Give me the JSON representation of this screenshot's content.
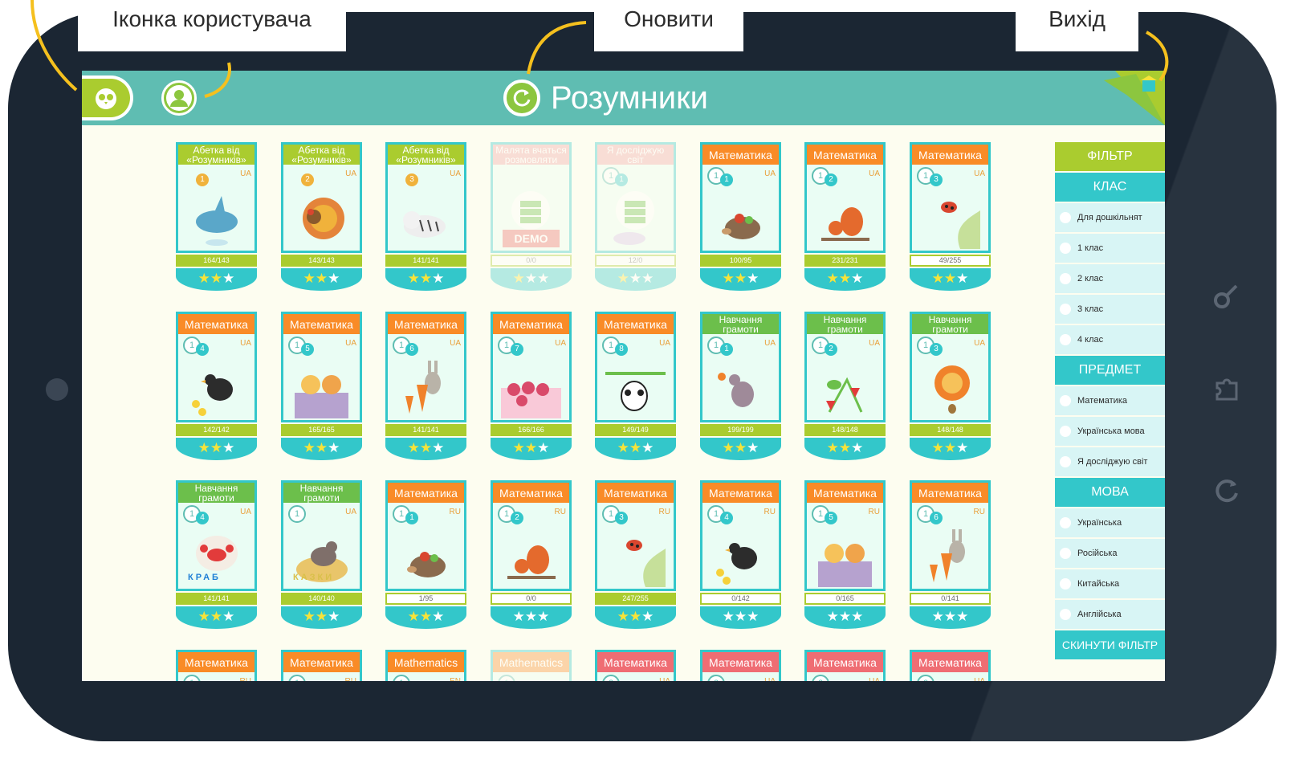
{
  "annotations": {
    "user_icon": "Іконка користувача",
    "refresh": "Оновити",
    "exit": "Вихід"
  },
  "app": {
    "title": "Розумники",
    "accent": "#5fbdb2",
    "green": "#aacc2f",
    "teal": "#33c7ca"
  },
  "icons": {
    "owl": "owl-icon",
    "user": "user-icon",
    "refresh": "refresh-icon",
    "exit": "exit-icon",
    "star": "★"
  },
  "filter": {
    "title": "ФІЛЬТР",
    "groups": [
      {
        "label": "КЛАС",
        "items": [
          "Для дошкільнят",
          "1 клас",
          "2 клас",
          "3 клас",
          "4 клас"
        ]
      },
      {
        "label": "ПРЕДМЕТ",
        "items": [
          "Математика",
          "Українська мова",
          "Я досліджую світ"
        ]
      },
      {
        "label": "МОВА",
        "items": [
          "Українська",
          "Російська",
          "Китайська",
          "Англійська"
        ]
      }
    ],
    "reset": "СКИНУТИ ФІЛЬТР"
  },
  "cards": [
    {
      "title": "Абетка від «Розумників»",
      "color": "#aacc2f",
      "grade": "",
      "lesson": "1",
      "lang": "UA",
      "score": "164/143",
      "status": "done",
      "art": "shark",
      "stars": 2
    },
    {
      "title": "Абетка від «Розумників»",
      "color": "#aacc2f",
      "grade": "",
      "lesson": "2",
      "lang": "UA",
      "score": "143/143",
      "status": "done",
      "art": "turkey",
      "stars": 2
    },
    {
      "title": "Абетка від «Розумників»",
      "color": "#aacc2f",
      "grade": "",
      "lesson": "3",
      "lang": "UA",
      "score": "141/141",
      "status": "done",
      "art": "tiger",
      "stars": 2
    },
    {
      "title": "Малята вчаться розмовляти",
      "color": "#f0a4a4",
      "grade": "",
      "lesson": "",
      "lang": "",
      "score": "0/0",
      "status": "open",
      "art": "demo",
      "badge": "DEMO",
      "faded": true,
      "stars": 1
    },
    {
      "title": "Я досліджую світ",
      "color": "#f0a4a4",
      "grade": "1",
      "lesson": "1",
      "lang": "",
      "score": "12/0",
      "status": "open",
      "art": "demo2",
      "faded": true,
      "stars": 1
    },
    {
      "title": "Математика",
      "color": "#f98b27",
      "grade": "1",
      "lesson": "1",
      "lang": "UA",
      "score": "100/95",
      "status": "done",
      "art": "hedgehog",
      "stars": 2
    },
    {
      "title": "Математика",
      "color": "#f98b27",
      "grade": "1",
      "lesson": "2",
      "lang": "UA",
      "score": "231/231",
      "status": "done",
      "art": "squirrel",
      "stars": 2
    },
    {
      "title": "Математика",
      "color": "#f98b27",
      "grade": "1",
      "lesson": "3",
      "lang": "UA",
      "score": "49/255",
      "status": "open",
      "art": "ladybug",
      "stars": 2
    },
    {
      "title": "Математика",
      "color": "#f98b27",
      "grade": "1",
      "lesson": "4",
      "lang": "UA",
      "score": "142/142",
      "status": "done",
      "art": "hen",
      "stars": 2
    },
    {
      "title": "Математика",
      "color": "#f98b27",
      "grade": "1",
      "lesson": "5",
      "lang": "UA",
      "score": "165/165",
      "status": "done",
      "art": "cats",
      "stars": 2
    },
    {
      "title": "Математика",
      "color": "#f98b27",
      "grade": "1",
      "lesson": "6",
      "lang": "UA",
      "score": "141/141",
      "status": "done",
      "art": "rabbit",
      "stars": 2
    },
    {
      "title": "Математика",
      "color": "#f98b27",
      "grade": "1",
      "lesson": "7",
      "lang": "UA",
      "score": "166/166",
      "status": "done",
      "art": "flowers",
      "stars": 2
    },
    {
      "title": "Математика",
      "color": "#f98b27",
      "grade": "1",
      "lesson": "8",
      "lang": "UA",
      "score": "149/149",
      "status": "done",
      "art": "panda",
      "stars": 2
    },
    {
      "title": "Навчання грамоти",
      "color": "#6cbf4b",
      "grade": "1",
      "lesson": "1",
      "lang": "UA",
      "score": "199/199",
      "status": "done",
      "art": "mouse",
      "stars": 2
    },
    {
      "title": "Навчання грамоти",
      "color": "#6cbf4b",
      "grade": "1",
      "lesson": "2",
      "lang": "UA",
      "score": "148/148",
      "status": "done",
      "art": "strawberry",
      "stars": 2
    },
    {
      "title": "Навчання грамоти",
      "color": "#6cbf4b",
      "grade": "1",
      "lesson": "3",
      "lang": "UA",
      "score": "148/148",
      "status": "done",
      "art": "fox",
      "stars": 2
    },
    {
      "title": "Навчання грамоти",
      "color": "#6cbf4b",
      "grade": "1",
      "lesson": "4",
      "lang": "UA",
      "score": "141/141",
      "status": "done",
      "art": "crab",
      "word": "КРАБ",
      "stars": 2
    },
    {
      "title": "Навчання грамоти",
      "color": "#6cbf4b",
      "grade": "1",
      "lesson": "",
      "lang": "UA",
      "score": "140/140",
      "status": "done",
      "art": "nest",
      "word": "КАЗКИ",
      "stars": 2
    },
    {
      "title": "Математика",
      "color": "#f98b27",
      "grade": "1",
      "lesson": "1",
      "lang": "RU",
      "score": "1/95",
      "status": "open",
      "art": "hedgehog",
      "stars": 2
    },
    {
      "title": "Математика",
      "color": "#f98b27",
      "grade": "1",
      "lesson": "2",
      "lang": "RU",
      "score": "0/0",
      "status": "open",
      "art": "squirrel",
      "stars": 0
    },
    {
      "title": "Математика",
      "color": "#f98b27",
      "grade": "1",
      "lesson": "3",
      "lang": "RU",
      "score": "247/255",
      "status": "done",
      "art": "ladybug",
      "stars": 2
    },
    {
      "title": "Математика",
      "color": "#f98b27",
      "grade": "1",
      "lesson": "4",
      "lang": "RU",
      "score": "0/142",
      "status": "open",
      "art": "hen",
      "stars": 0
    },
    {
      "title": "Математика",
      "color": "#f98b27",
      "grade": "1",
      "lesson": "5",
      "lang": "RU",
      "score": "0/165",
      "status": "open",
      "art": "cats",
      "stars": 0
    },
    {
      "title": "Математика",
      "color": "#f98b27",
      "grade": "1",
      "lesson": "6",
      "lang": "RU",
      "score": "0/141",
      "status": "open",
      "art": "rabbit",
      "stars": 0
    },
    {
      "title": "Математика",
      "color": "#f98b27",
      "grade": "1",
      "lesson": "",
      "lang": "RU",
      "score": "",
      "status": "open",
      "art": "",
      "stars": 0
    },
    {
      "title": "Математика",
      "color": "#f98b27",
      "grade": "1",
      "lesson": "",
      "lang": "RU",
      "score": "",
      "status": "open",
      "art": "",
      "stars": 0
    },
    {
      "title": "Mathematics",
      "color": "#f98b27",
      "grade": "1",
      "lesson": "",
      "lang": "EN",
      "score": "",
      "status": "open",
      "art": "",
      "stars": 0
    },
    {
      "title": "Mathematics",
      "color": "#f98b27",
      "grade": "1",
      "lesson": "",
      "lang": "",
      "score": "",
      "status": "open",
      "art": "",
      "faded": true,
      "stars": 0
    },
    {
      "title": "Математика",
      "color": "#ef6d73",
      "grade": "2",
      "lesson": "",
      "lang": "UA",
      "score": "",
      "status": "open",
      "art": "",
      "stars": 0
    },
    {
      "title": "Математика",
      "color": "#ef6d73",
      "grade": "2",
      "lesson": "",
      "lang": "UA",
      "score": "",
      "status": "open",
      "art": "",
      "stars": 0
    },
    {
      "title": "Математика",
      "color": "#ef6d73",
      "grade": "2",
      "lesson": "",
      "lang": "UA",
      "score": "",
      "status": "open",
      "art": "",
      "stars": 0
    },
    {
      "title": "Математика",
      "color": "#ef6d73",
      "grade": "2",
      "lesson": "",
      "lang": "UA",
      "score": "",
      "status": "open",
      "art": "",
      "stars": 0
    }
  ]
}
